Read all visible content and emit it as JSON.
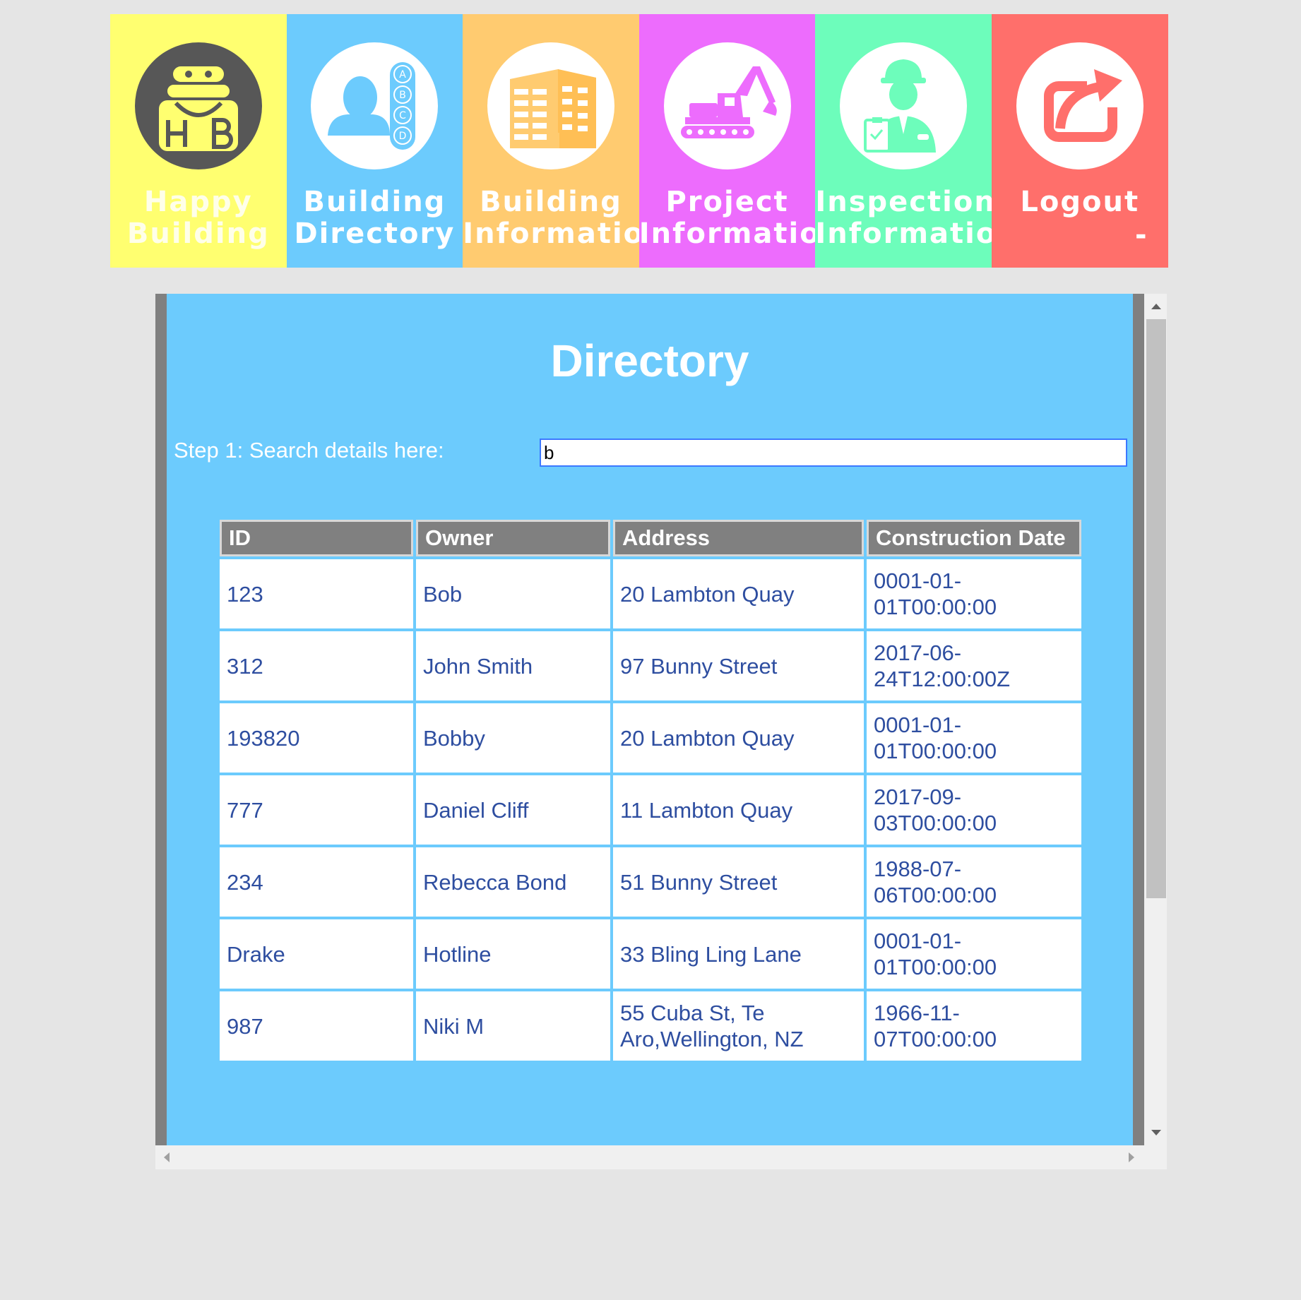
{
  "nav": {
    "home": {
      "line1": "Happy",
      "line2": "Building",
      "logo_text": "H B",
      "icon": "happy-building-logo-icon"
    },
    "directory": {
      "line1": "Building",
      "line2": "Directory",
      "icon": "person-abcd-directory-icon",
      "abcd": [
        "A",
        "B",
        "C",
        "D"
      ]
    },
    "building": {
      "line1": "Building",
      "line2": "Information",
      "icon": "office-building-icon"
    },
    "project": {
      "line1": "Project",
      "line2": "Information",
      "icon": "excavator-icon"
    },
    "inspection": {
      "line1": "Inspection",
      "line2": "Information",
      "icon": "inspector-hardhat-icon"
    },
    "logout": {
      "line1": "Logout",
      "line2": "-",
      "icon": "share-export-icon"
    }
  },
  "colors": {
    "home": "#ffff70",
    "directory": "#6ccbfd",
    "building": "#ffcb70",
    "project": "#ed6cfd",
    "inspection": "#6dfdbb",
    "logout": "#ff6f6b"
  },
  "page": {
    "title": "Directory",
    "search_label": "Step 1: Search details here:",
    "search_value": "b"
  },
  "table": {
    "headers": [
      "ID",
      "Owner",
      "Address",
      "Construction Date"
    ],
    "rows": [
      {
        "id": "123",
        "owner": "Bob",
        "address": "20 Lambton Quay",
        "date": "0001-01-01T00:00:00"
      },
      {
        "id": "312",
        "owner": "John Smith",
        "address": "97 Bunny Street",
        "date": "2017-06-24T12:00:00Z"
      },
      {
        "id": "193820",
        "owner": "Bobby",
        "address": "20 Lambton Quay",
        "date": "0001-01-01T00:00:00"
      },
      {
        "id": "777",
        "owner": "Daniel Cliff",
        "address": "11 Lambton Quay",
        "date": "2017-09-03T00:00:00"
      },
      {
        "id": "234",
        "owner": "Rebecca Bond",
        "address": "51 Bunny Street",
        "date": "1988-07-06T00:00:00"
      },
      {
        "id": "Drake",
        "owner": "Hotline",
        "address": "33 Bling Ling Lane",
        "date": "0001-01-01T00:00:00"
      },
      {
        "id": "987",
        "owner": "Niki M",
        "address": "55 Cuba St, Te Aro,Wellington, NZ",
        "date": "1966-11-07T00:00:00"
      }
    ]
  }
}
